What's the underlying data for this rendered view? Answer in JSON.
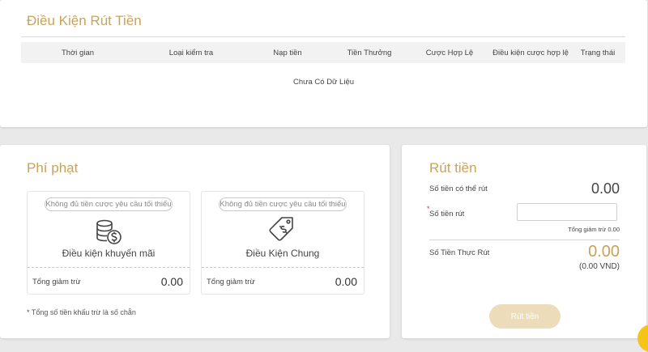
{
  "conditions": {
    "title": "Điều Kiện Rút Tiền",
    "columns": [
      "Thời gian",
      "Loại kiểm tra",
      "Nạp tiền",
      "Tiền Thưởng",
      "Cược Hợp Lệ",
      "Điều kiện cược hợp lệ",
      "Trạng thái"
    ],
    "empty_text": "Chưa Có Dữ Liệu"
  },
  "penalty": {
    "title": "Phí phạt",
    "boxes": [
      {
        "badge": "Không đủ tiền cược yêu cầu tối thiểu",
        "icon": "coin-stack-dollar-icon",
        "label": "Điều kiện khuyến mãi",
        "sub_label": "Tổng giảm trừ",
        "value": "0.00"
      },
      {
        "badge": "Không đủ tiền cược yêu cầu tối thiểu",
        "icon": "price-tag-dollar-icon",
        "label": "Điều Kiện Chung",
        "sub_label": "Tổng giảm trừ",
        "value": "0.00"
      }
    ],
    "note": "* Tổng số tiền khấu trừ là số chẵn"
  },
  "withdraw": {
    "title": "Rút tiền",
    "available_label": "Số tiền có thể rút",
    "available_value": "0.00",
    "required_marker": "*",
    "amount_label": "Số tiền rút",
    "amount_value": "",
    "amount_placeholder": "",
    "min_note": "Tổng giảm trừ 0.00",
    "actual_label": "Số Tiền Thực Rút",
    "actual_value": "0.00",
    "actual_sub": "(0.00 VND)",
    "button_label": "Rút tiền"
  },
  "colors": {
    "accent": "#c9a35a",
    "button_bg": "#ecdcb9",
    "badge": "#f5c419"
  }
}
